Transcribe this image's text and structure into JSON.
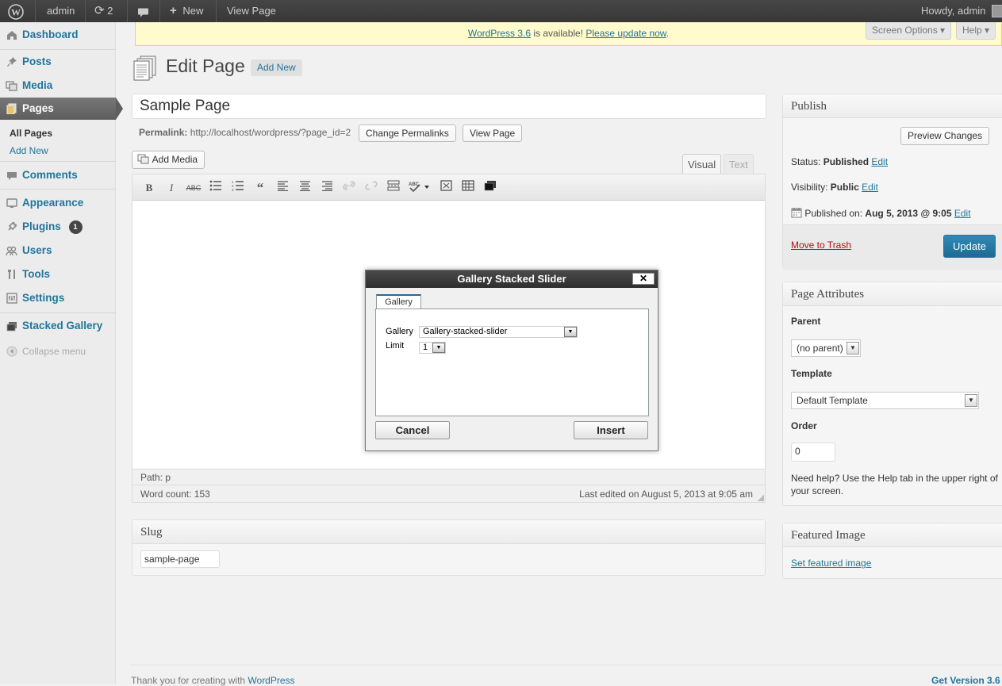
{
  "adminbar": {
    "site": "admin",
    "updates_count": "2",
    "new_label": "New",
    "view_page": "View Page",
    "howdy": "Howdy, admin"
  },
  "menu": {
    "dashboard": "Dashboard",
    "posts": "Posts",
    "media": "Media",
    "pages": "Pages",
    "pages_sub": [
      "All Pages",
      "Add New"
    ],
    "comments": "Comments",
    "appearance": "Appearance",
    "plugins": "Plugins",
    "plugins_badge": "1",
    "users": "Users",
    "tools": "Tools",
    "settings": "Settings",
    "stacked_gallery": "Stacked Gallery",
    "collapse": "Collapse menu"
  },
  "nag": {
    "version_link": "WordPress 3.6",
    "middle": " is available! ",
    "update_link": "Please update now",
    "end": "."
  },
  "screen_meta": {
    "options": "Screen Options ▾",
    "help": "Help ▾"
  },
  "header": {
    "title": "Edit Page",
    "add_new": "Add New"
  },
  "editor": {
    "page_title": "Sample Page",
    "permalink_label": "Permalink:",
    "permalink_url": "http://localhost/wordpress/?page_id=2",
    "change_permalinks": "Change Permalinks",
    "view_page": "View Page",
    "add_media": "Add Media",
    "tab_visual": "Visual",
    "tab_text": "Text",
    "path": "Path: p",
    "word_count": "Word count: 153",
    "last_edited": "Last edited on August 5, 2013 at 9:05 am"
  },
  "slug": {
    "title": "Slug",
    "value": "sample-page"
  },
  "publish": {
    "title": "Publish",
    "preview": "Preview Changes",
    "status_label": "Status: ",
    "status_value": "Published",
    "visibility_label": "Visibility: ",
    "visibility_value": "Public",
    "published_label": "Published on: ",
    "published_value": "Aug 5, 2013 @ 9:05",
    "edit": "Edit",
    "trash": "Move to Trash",
    "update": "Update"
  },
  "attributes": {
    "title": "Page Attributes",
    "parent_label": "Parent",
    "parent_value": "(no parent)",
    "template_label": "Template",
    "template_value": "Default Template",
    "order_label": "Order",
    "order_value": "0",
    "help_text": "Need help? Use the Help tab in the upper right of your screen."
  },
  "featured": {
    "title": "Featured Image",
    "link": "Set featured image"
  },
  "dialog": {
    "title": "Gallery Stacked Slider",
    "close": "✕",
    "tab": "Gallery",
    "gallery_label": "Gallery",
    "gallery_value": "Gallery-stacked-slider",
    "limit_label": "Limit",
    "limit_value": "1",
    "cancel": "Cancel",
    "insert": "Insert"
  },
  "footer": {
    "thanks": "Thank you for creating with ",
    "wp_link": "WordPress",
    "version": "Get Version 3.6"
  },
  "colors": {
    "adminbar": "#464646",
    "link": "#21759b",
    "update_button": "#2e8ab8",
    "nag_bg": "#fffbcc",
    "dialog_header": "#3a3a3a"
  }
}
